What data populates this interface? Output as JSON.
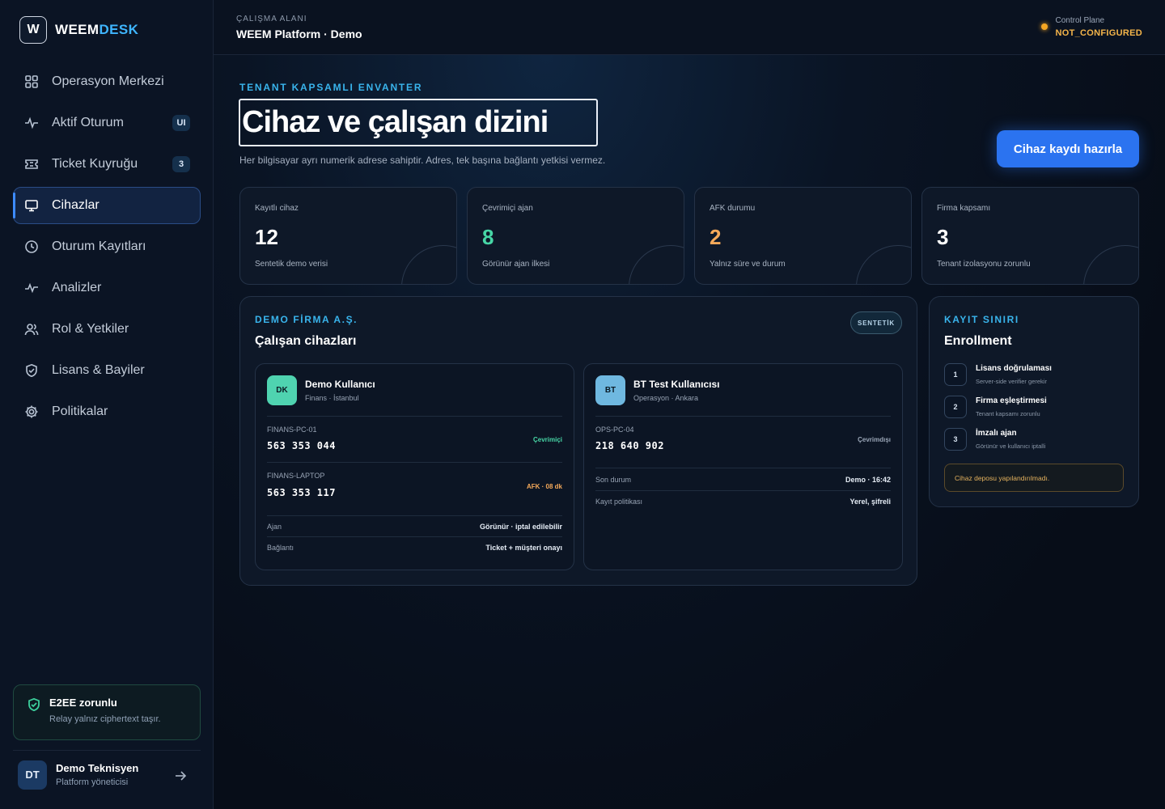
{
  "brand": {
    "logo_letter": "W",
    "name_part1": "WEEM",
    "name_part2": "DESK",
    "accent": "#3fb6ff"
  },
  "sidebar": {
    "items": [
      {
        "label": "Operasyon Merkezi",
        "icon": "grid-icon"
      },
      {
        "label": "Aktif Oturum",
        "icon": "activity-icon",
        "badge": "UI"
      },
      {
        "label": "Ticket Kuyruğu",
        "icon": "ticket-icon",
        "badge": "3"
      },
      {
        "label": "Cihazlar",
        "icon": "monitor-icon",
        "active": true
      },
      {
        "label": "Oturum Kayıtları",
        "icon": "clock-icon"
      },
      {
        "label": "Analizler",
        "icon": "pulse-icon"
      },
      {
        "label": "Rol & Yetkiler",
        "icon": "users-icon"
      },
      {
        "label": "Lisans & Bayiler",
        "icon": "shield-check-icon"
      },
      {
        "label": "Politikalar",
        "icon": "gear-icon"
      }
    ],
    "e2ee": {
      "title": "E2EE zorunlu",
      "subtitle": "Relay yalnız ciphertext taşır.",
      "icon": "shield-check-icon"
    },
    "user": {
      "initials": "DT",
      "name": "Demo Teknisyen",
      "role": "Platform yöneticisi",
      "icon": "arrow-right-icon"
    }
  },
  "topbar": {
    "workspace_label": "ÇALIŞMA ALANI",
    "workspace_name": "WEEM Platform · Demo",
    "control_plane_label": "Control Plane",
    "control_plane_status": "NOT_CONFIGURED",
    "status_color": "#f5a623"
  },
  "header": {
    "eyebrow": "TENANT KAPSAMLI ENVANTER",
    "title": "Cihaz ve çalışan dizini",
    "subtitle": "Her bilgisayar ayrı numerik adrese sahiptir. Adres, tek başına bağlantı yetkisi vermez.",
    "primary_button": "Cihaz kaydı hazırla"
  },
  "stats": [
    {
      "label": "Kayıtlı cihaz",
      "value": "12",
      "note": "Sentetik demo verisi",
      "color": "#ffffff"
    },
    {
      "label": "Çevrimiçi ajan",
      "value": "8",
      "note": "Görünür ajan ilkesi",
      "color": "#47d6a6"
    },
    {
      "label": "AFK durumu",
      "value": "2",
      "note": "Yalnız süre ve durum",
      "color": "#f5a95a"
    },
    {
      "label": "Firma kapsamı",
      "value": "3",
      "note": "Tenant izolasyonu zorunlu",
      "color": "#ffffff"
    }
  ],
  "company_panel": {
    "eyebrow": "DEMO FİRMA A.Ş.",
    "title": "Çalışan cihazları",
    "badge": "SENTETİK",
    "employees": [
      {
        "initials": "DK",
        "name": "Demo Kullanıcı",
        "dept": "Finans · İstanbul",
        "avatar_color": "#4fd3b0",
        "devices": [
          {
            "id": "FINANS-PC-01",
            "address": "563 353 044",
            "status": "Çevrimiçi",
            "status_color": "#47d6a6"
          },
          {
            "id": "FINANS-LAPTOP",
            "address": "563 353 117",
            "status": "AFK · 08 dk",
            "status_color": "#f5a95a"
          }
        ],
        "kv": [
          {
            "key": "Ajan",
            "value": "Görünür · iptal edilebilir"
          },
          {
            "key": "Bağlantı",
            "value": "Ticket + müşteri onayı"
          }
        ]
      },
      {
        "initials": "BT",
        "name": "BT Test Kullanıcısı",
        "dept": "Operasyon · Ankara",
        "avatar_color": "#6fb8e0",
        "devices": [
          {
            "id": "OPS-PC-04",
            "address": "218 640 902",
            "status": "Çevrimdışı",
            "status_color": "#9aa6b7"
          }
        ],
        "kv": [
          {
            "key": "Son durum",
            "value": "Demo · 16:42"
          },
          {
            "key": "Kayıt politikası",
            "value": "Yerel, şifreli"
          }
        ]
      }
    ]
  },
  "enrollment_panel": {
    "eyebrow": "KAYIT SINIRI",
    "title": "Enrollment",
    "steps": [
      {
        "num": "1",
        "title": "Lisans doğrulaması",
        "sub": "Server-side verifier gerekir"
      },
      {
        "num": "2",
        "title": "Firma eşleştirmesi",
        "sub": "Tenant kapsamı zorunlu"
      },
      {
        "num": "3",
        "title": "İmzalı ajan",
        "sub": "Görünür ve kullanıcı iptalli"
      }
    ],
    "warning": "Cihaz deposu yapılandırılmadı."
  }
}
